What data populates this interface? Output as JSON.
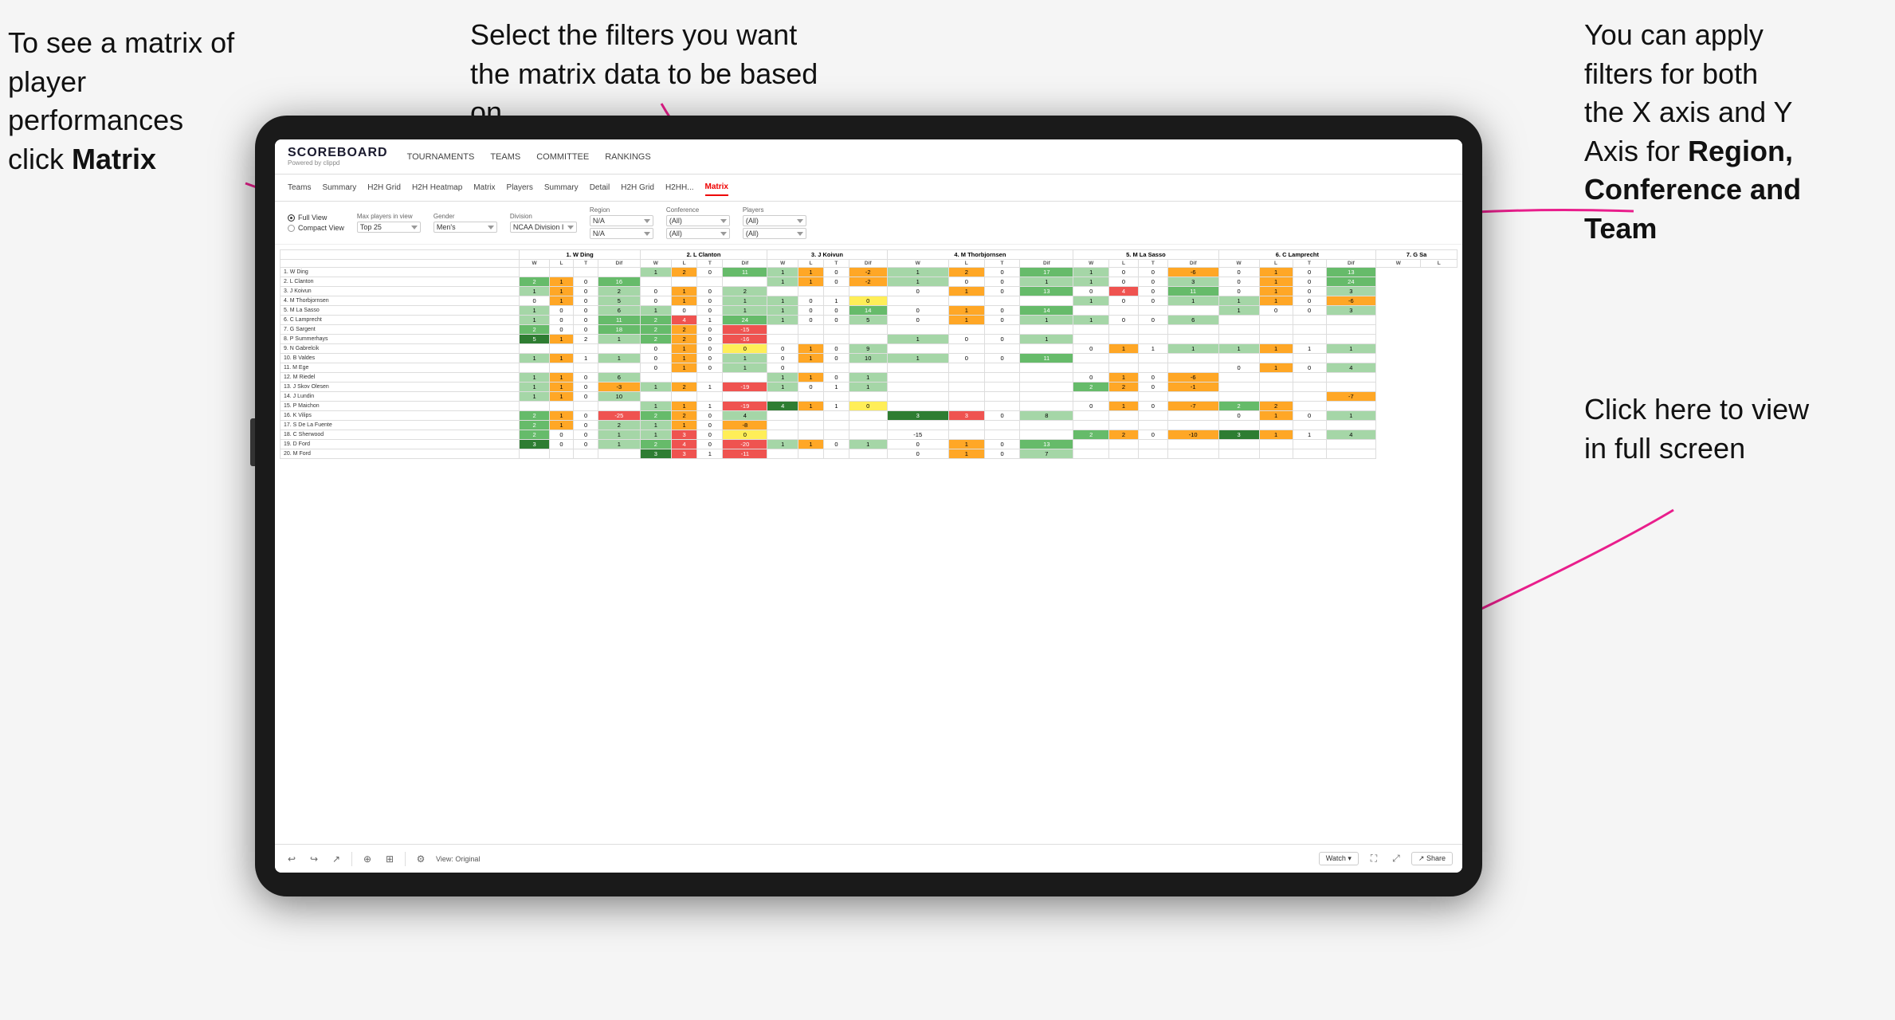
{
  "annotations": {
    "left": {
      "line1": "To see a matrix of",
      "line2": "player performances",
      "line3_normal": "click ",
      "line3_bold": "Matrix"
    },
    "center": {
      "text": "Select the filters you want the matrix data to be based on"
    },
    "right_top": {
      "line1": "You  can apply",
      "line2": "filters for both",
      "line3": "the X axis and Y",
      "line4_normal": "Axis for ",
      "line4_bold": "Region,",
      "line5_bold": "Conference and",
      "line6_bold": "Team"
    },
    "right_bottom": {
      "line1": "Click here to view",
      "line2": "in full screen"
    }
  },
  "app": {
    "logo": "SCOREBOARD",
    "logo_sub": "Powered by clippd",
    "nav": [
      "TOURNAMENTS",
      "TEAMS",
      "COMMITTEE",
      "RANKINGS"
    ],
    "subnav_players": [
      "Teams",
      "Summary",
      "H2H Grid",
      "H2H Heatmap",
      "Matrix",
      "Players",
      "Summary",
      "Detail",
      "H2H Grid",
      "H2HH...",
      "Matrix"
    ],
    "active_tab": "Matrix"
  },
  "filters": {
    "view_options": [
      "Full View",
      "Compact View"
    ],
    "selected_view": "Full View",
    "max_players_label": "Max players in view",
    "max_players_value": "Top 25",
    "gender_label": "Gender",
    "gender_value": "Men's",
    "division_label": "Division",
    "division_value": "NCAA Division I",
    "region_label": "Region",
    "region_value": "N/A",
    "region_value2": "N/A",
    "conference_label": "Conference",
    "conference_value": "(All)",
    "conference_value2": "(All)",
    "players_label": "Players",
    "players_value": "(All)",
    "players_value2": "(All)"
  },
  "matrix": {
    "col_headers": [
      "1. W Ding",
      "2. L Clanton",
      "3. J Koivun",
      "4. M Thorbjornsen",
      "5. M La Sasso",
      "6. C Lamprecht",
      "7. G Sa"
    ],
    "sub_headers": [
      "W",
      "L",
      "T",
      "Dif"
    ],
    "rows": [
      {
        "name": "1. W Ding",
        "cells": [
          "",
          "",
          "",
          "",
          "1",
          "2",
          "0",
          "11",
          "1",
          "1",
          "0",
          "-2",
          "1",
          "2",
          "0",
          "17",
          "1",
          "0",
          "0",
          "-6",
          "0",
          "1",
          "0",
          "13"
        ]
      },
      {
        "name": "2. L Clanton",
        "cells": [
          "2",
          "1",
          "0",
          "16",
          "",
          "",
          "",
          "",
          "1",
          "1",
          "0",
          "-2",
          "1",
          "0",
          "0",
          "1",
          "1",
          "0",
          "0",
          "3",
          "0",
          "1",
          "0",
          "24"
        ]
      },
      {
        "name": "3. J Koivun",
        "cells": [
          "1",
          "1",
          "0",
          "2",
          "0",
          "1",
          "0",
          "2",
          "",
          "",
          "",
          "",
          "0",
          "1",
          "0",
          "13",
          "0",
          "4",
          "0",
          "11",
          "0",
          "1",
          "0",
          "3"
        ]
      },
      {
        "name": "4. M Thorbjornsen",
        "cells": [
          "0",
          "1",
          "0",
          "5",
          "0",
          "1",
          "0",
          "1",
          "1",
          "0",
          "1",
          "0",
          "",
          "",
          "",
          "",
          "1",
          "0",
          "0",
          "1",
          "1",
          "1",
          "0",
          "-6"
        ]
      },
      {
        "name": "5. M La Sasso",
        "cells": [
          "1",
          "0",
          "0",
          "6",
          "1",
          "0",
          "0",
          "1",
          "1",
          "0",
          "0",
          "14",
          "0",
          "1",
          "0",
          "14",
          "",
          "",
          "",
          "",
          "1",
          "0",
          "0",
          "3"
        ]
      },
      {
        "name": "6. C Lamprecht",
        "cells": [
          "1",
          "0",
          "0",
          "11",
          "2",
          "4",
          "1",
          "24",
          "1",
          "0",
          "0",
          "5",
          "0",
          "1",
          "0",
          "1",
          "1",
          "0",
          "0",
          "6",
          "",
          "",
          "",
          ""
        ]
      },
      {
        "name": "7. G Sargent",
        "cells": [
          "2",
          "0",
          "0",
          "18",
          "2",
          "2",
          "0",
          "-15",
          "",
          "",
          "",
          "",
          "",
          "",
          "",
          "",
          "",
          "",
          "",
          "",
          "",
          "",
          "",
          ""
        ]
      },
      {
        "name": "8. P Summerhays",
        "cells": [
          "5",
          "1",
          "2",
          "1",
          "2",
          "2",
          "0",
          "-16",
          "",
          "",
          "",
          "",
          "1",
          "0",
          "0",
          "1",
          "",
          "",
          "",
          "",
          "",
          "",
          "",
          ""
        ]
      },
      {
        "name": "9. N Gabrelcik",
        "cells": [
          "",
          "",
          "",
          "",
          "0",
          "1",
          "0",
          "0",
          "0",
          "1",
          "0",
          "9",
          "",
          "",
          "",
          "",
          "0",
          "1",
          "1",
          "1",
          "1",
          "1",
          "1",
          "1"
        ]
      },
      {
        "name": "10. B Valdes",
        "cells": [
          "1",
          "1",
          "1",
          "1",
          "0",
          "1",
          "0",
          "1",
          "0",
          "1",
          "0",
          "10",
          "1",
          "0",
          "0",
          "11",
          "",
          "",
          "",
          "",
          "",
          "",
          "",
          ""
        ]
      },
      {
        "name": "11. M Ege",
        "cells": [
          "",
          "",
          "",
          "",
          "0",
          "1",
          "0",
          "1",
          "0",
          "",
          "",
          "",
          "",
          "",
          "",
          "",
          "",
          "",
          "",
          "",
          "0",
          "1",
          "0",
          "4"
        ]
      },
      {
        "name": "12. M Riedel",
        "cells": [
          "1",
          "1",
          "0",
          "6",
          "",
          "",
          "",
          "",
          "1",
          "1",
          "0",
          "1",
          "",
          "",
          "",
          "",
          "0",
          "1",
          "0",
          "-6",
          "",
          "",
          "",
          ""
        ]
      },
      {
        "name": "13. J Skov Olesen",
        "cells": [
          "1",
          "1",
          "0",
          "-3",
          "1",
          "2",
          "1",
          "-19",
          "1",
          "0",
          "1",
          "1",
          "",
          "",
          "",
          "",
          "2",
          "2",
          "0",
          "-1",
          "",
          "",
          "",
          ""
        ]
      },
      {
        "name": "14. J Lundin",
        "cells": [
          "1",
          "1",
          "0",
          "10",
          "",
          "",
          "",
          "",
          "",
          "",
          "",
          "",
          "",
          "",
          "",
          "",
          "",
          "",
          "",
          "",
          "",
          "",
          "",
          "-7"
        ]
      },
      {
        "name": "15. P Maichon",
        "cells": [
          "",
          "",
          "",
          "",
          "1",
          "1",
          "1",
          "-19",
          "4",
          "1",
          "1",
          "0",
          "",
          "",
          "",
          "",
          "0",
          "1",
          "0",
          "-7",
          "2",
          "2",
          "",
          ""
        ]
      },
      {
        "name": "16. K Vilips",
        "cells": [
          "2",
          "1",
          "0",
          "-25",
          "2",
          "2",
          "0",
          "4",
          "",
          "",
          "",
          "",
          "3",
          "3",
          "0",
          "8",
          "",
          "",
          "",
          "",
          "0",
          "1",
          "0",
          "1"
        ]
      },
      {
        "name": "17. S De La Fuente",
        "cells": [
          "2",
          "1",
          "0",
          "2",
          "1",
          "1",
          "0",
          "-8",
          "",
          "",
          "",
          "",
          "",
          "",
          "",
          "",
          "",
          "",
          "",
          "",
          "",
          "",
          "",
          ""
        ]
      },
      {
        "name": "18. C Sherwood",
        "cells": [
          "2",
          "0",
          "0",
          "1",
          "1",
          "3",
          "0",
          "0",
          "",
          "",
          "",
          "",
          "-15",
          "",
          "",
          "",
          "2",
          "2",
          "0",
          "-10",
          "3",
          "1",
          "1",
          "4"
        ]
      },
      {
        "name": "19. D Ford",
        "cells": [
          "3",
          "0",
          "0",
          "1",
          "2",
          "4",
          "0",
          "-20",
          "1",
          "1",
          "0",
          "1",
          "0",
          "1",
          "0",
          "13",
          "",
          "",
          "",
          "",
          "",
          "",
          "",
          ""
        ]
      },
      {
        "name": "20. M Ford",
        "cells": [
          "",
          "",
          "",
          "",
          "3",
          "3",
          "1",
          "-11",
          "",
          "",
          "",
          "",
          "0",
          "1",
          "0",
          "7",
          "",
          "",
          "",
          "",
          "",
          "",
          "",
          ""
        ]
      }
    ]
  },
  "toolbar": {
    "view_label": "View: Original",
    "watch_label": "Watch",
    "share_label": "Share"
  }
}
